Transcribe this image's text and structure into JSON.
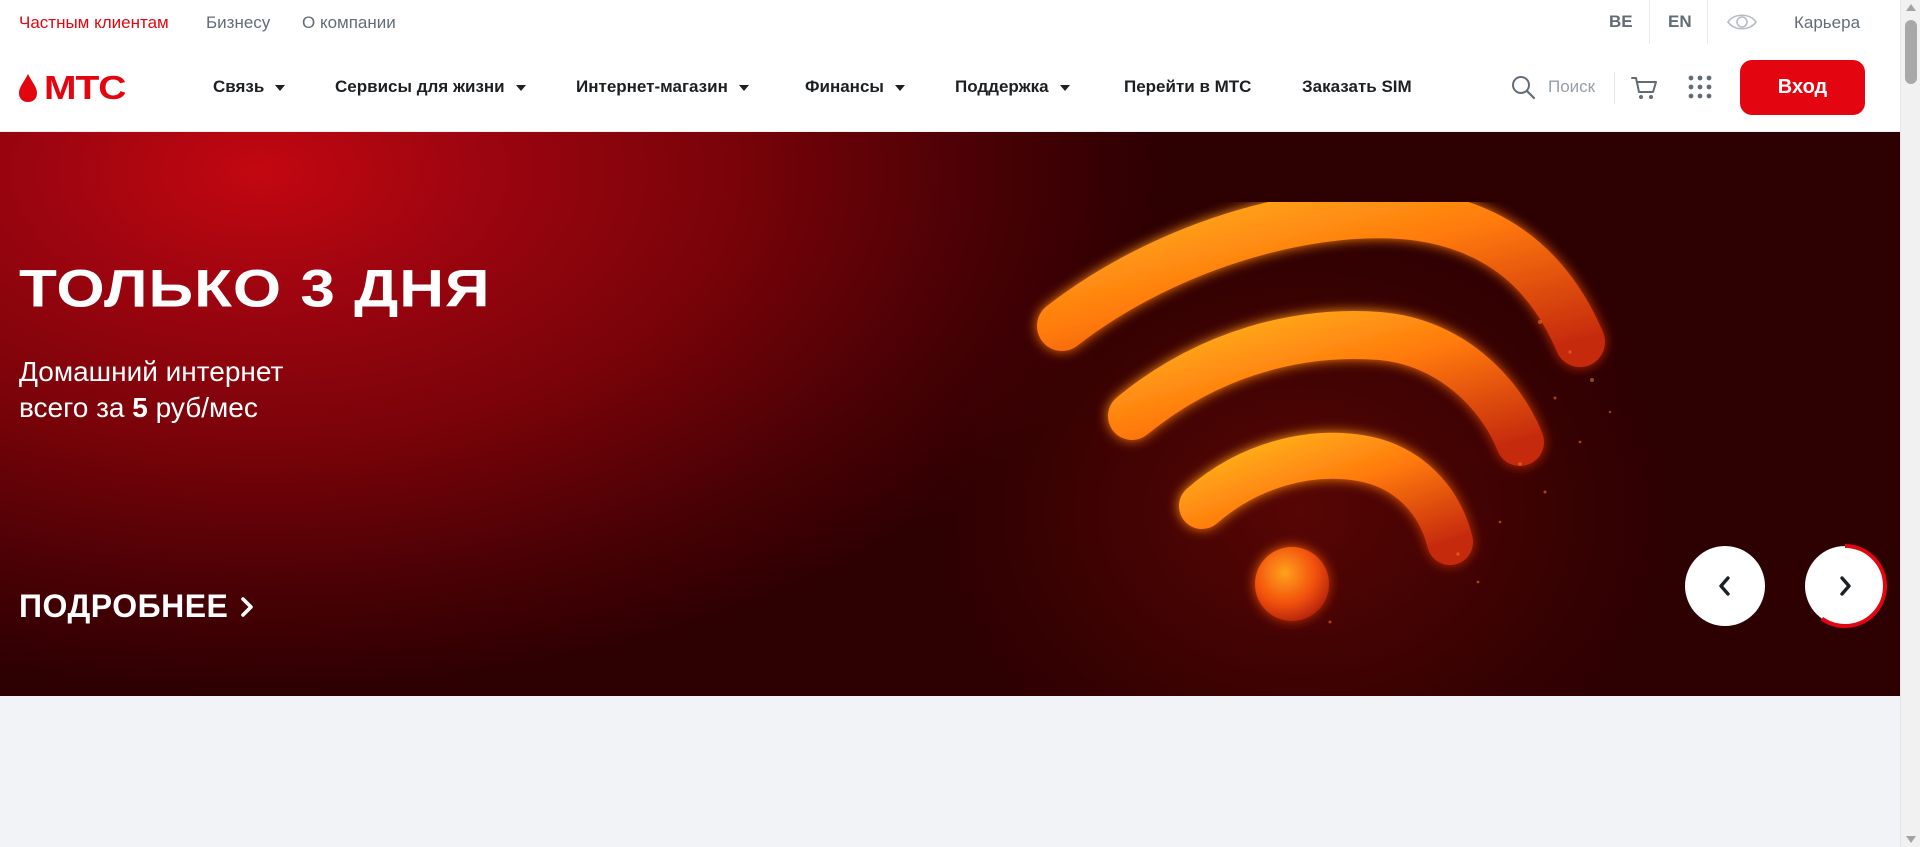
{
  "topbar": {
    "segments": [
      "Частным клиентам",
      "Бизнесу",
      "О компании"
    ],
    "languages": [
      "BE",
      "EN"
    ],
    "accessibility_icon": "eye-icon",
    "career": "Карьера"
  },
  "nav": {
    "logo_text": "МТС",
    "items": [
      "Связь",
      "Сервисы для жизни",
      "Интернет-магазин",
      "Финансы",
      "Поддержка",
      "Перейти в МТС",
      "Заказать SIM"
    ],
    "search_label": "Поиск",
    "icons": [
      "search-icon",
      "cart-icon",
      "apps-grid-icon"
    ],
    "login_label": "Вход"
  },
  "hero": {
    "title": "ТОЛЬКО 3 ДНЯ",
    "subtitle_line1": "Домашний интернет",
    "subtitle_prefix": "всего за ",
    "price": "5",
    "subtitle_suffix": " руб/мес",
    "more_label": "ПОДРОБНЕЕ",
    "illustration": "wifi-icon"
  },
  "colors": {
    "brand_red": "#e30611",
    "text_dark": "#1d2023",
    "text_muted": "#626c77",
    "page_bg": "#f2f3f7"
  }
}
